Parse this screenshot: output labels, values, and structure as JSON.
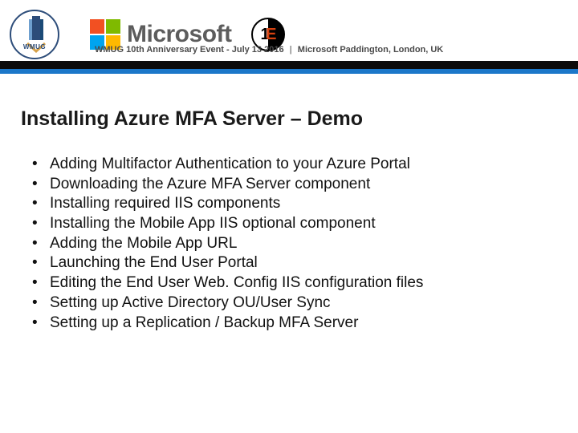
{
  "header": {
    "wmug_label": "WMUG",
    "microsoft_label": "Microsoft",
    "onee_digit1": "1",
    "onee_digit2": "E",
    "tagline_left": "WMUG 10th Anniversary Event - July 13 2016",
    "tagline_right": "Microsoft Paddington, London, UK"
  },
  "title": "Installing Azure MFA Server – Demo",
  "bullets": [
    "Adding Multifactor Authentication to your Azure Portal",
    "Downloading the Azure MFA Server component",
    "Installing required IIS components",
    "Installing the Mobile App IIS optional component",
    "Adding the Mobile App URL",
    "Launching the End User Portal",
    "Editing the End User Web. Config IIS configuration files",
    "Setting up Active Directory OU/User Sync",
    "Setting up a Replication / Backup MFA Server"
  ]
}
